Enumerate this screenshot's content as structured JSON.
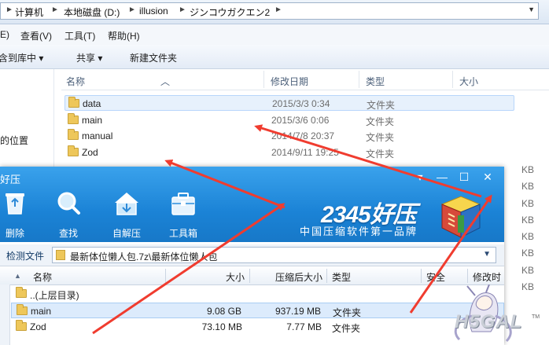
{
  "explorer": {
    "breadcrumb": [
      "计算机",
      "本地磁盘 (D:)",
      "illusion",
      "ジンコウガクエン2"
    ],
    "menu": [
      "E)",
      "查看(V)",
      "工具(T)",
      "帮助(H)"
    ],
    "toolbar": [
      "包含到库中 ▾",
      "共享 ▾",
      "新建文件夹"
    ],
    "nav_partial": "问的位置",
    "columns": {
      "name": "名称",
      "date": "修改日期",
      "type": "类型",
      "size": "大小"
    },
    "files": [
      {
        "name": "data",
        "date": "2015/3/3 0:34",
        "type": "文件夹"
      },
      {
        "name": "main",
        "date": "2015/3/6 0:06",
        "type": "文件夹"
      },
      {
        "name": "manual",
        "date": "2014/7/8 20:37",
        "type": "文件夹"
      },
      {
        "name": "Zod",
        "date": "2014/9/11 19:25",
        "type": "文件夹"
      }
    ],
    "kb_unit": "KB"
  },
  "haozip": {
    "title": "好压",
    "window_buttons": {
      "menu": "▾",
      "minimize": "—",
      "maximize": "☐",
      "close": "✕"
    },
    "tools": [
      {
        "label": "删除",
        "icon": "recycle-bin-icon"
      },
      {
        "label": "查找",
        "icon": "magnifier-icon"
      },
      {
        "label": "自解压",
        "icon": "self-extract-house-icon"
      },
      {
        "label": "工具箱",
        "icon": "toolbox-icon"
      }
    ],
    "brand": "2345好压",
    "slogan": "中国压缩软件第一品牌",
    "detect_label": "检测文件",
    "path": "最新体位懒人包.7z\\最新体位懒人包",
    "columns": {
      "name": "名称",
      "size": "大小",
      "csize": "压缩后大小",
      "type": "类型",
      "security": "安全",
      "modified": "修改时"
    },
    "rows": [
      {
        "name": "..(上层目录)",
        "size": "",
        "csize": "",
        "type": ""
      },
      {
        "name": "main",
        "size": "9.08 GB",
        "csize": "937.19 MB",
        "type": "文件夹"
      },
      {
        "name": "Zod",
        "size": "73.10 MB",
        "csize": "7.77 MB",
        "type": "文件夹"
      }
    ]
  },
  "watermark": {
    "text": "H5GAL",
    "tm": "TM"
  },
  "colors": {
    "haozip_blue": "#1b83d6",
    "arrow_red": "#f03c2f",
    "folder_yellow": "#eec75a"
  }
}
